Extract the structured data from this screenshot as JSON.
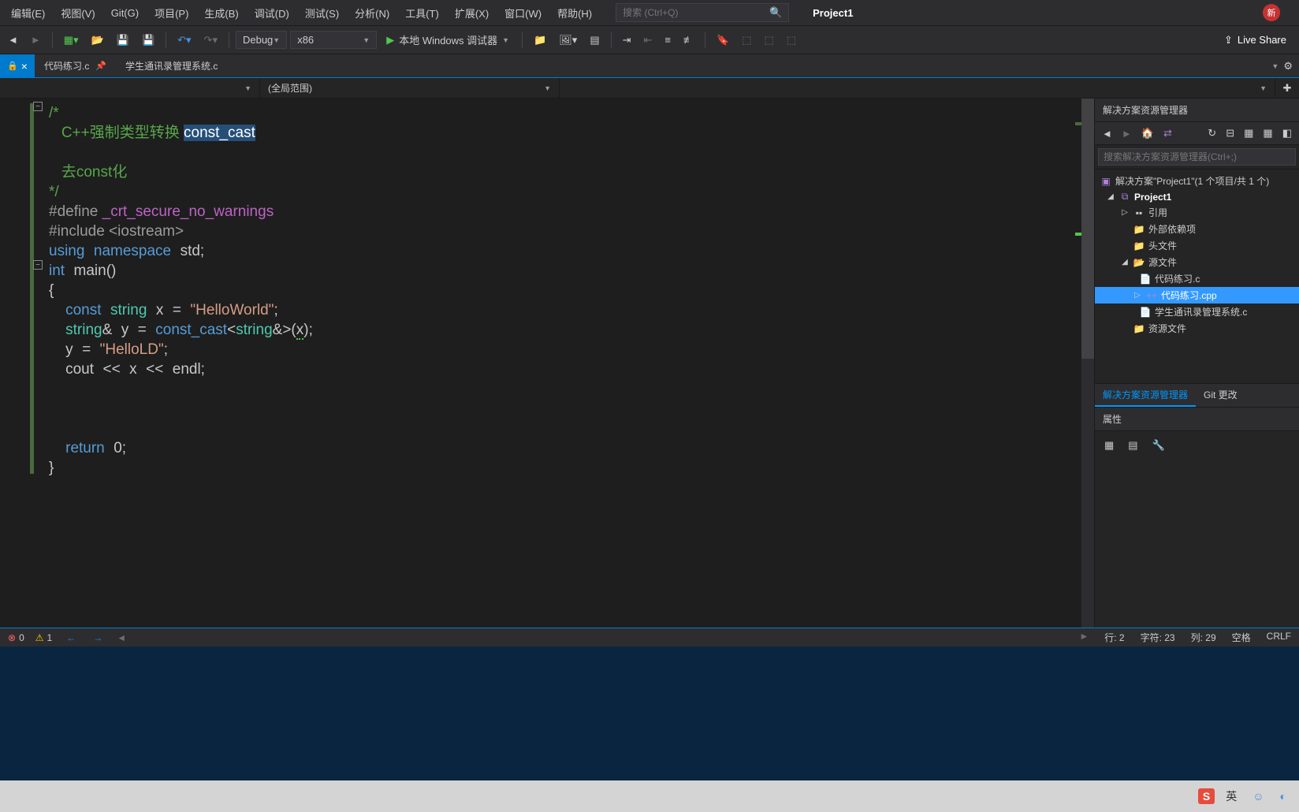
{
  "menu": {
    "items": [
      "编辑(E)",
      "视图(V)",
      "Git(G)",
      "项目(P)",
      "生成(B)",
      "调试(D)",
      "测试(S)",
      "分析(N)",
      "工具(T)",
      "扩展(X)",
      "窗口(W)",
      "帮助(H)"
    ],
    "search_placeholder": "搜索 (Ctrl+Q)",
    "project_name": "Project1",
    "badge": "新"
  },
  "toolbar": {
    "config": "Debug",
    "platform": "x86",
    "debugger": "本地 Windows 调试器",
    "live_share": "Live Share"
  },
  "tabs": {
    "items": [
      {
        "label": "代码练习.c",
        "active": false,
        "locked": true
      },
      {
        "label": "学生通讯录管理系统.c",
        "active": false,
        "locked": false
      }
    ]
  },
  "navbar": {
    "scope": "(全局范围)"
  },
  "code": {
    "comment_open": "/*",
    "comment_line1_prefix": "   C++强制类型转换 ",
    "comment_highlighted": "const_cast",
    "comment_line2": "   去const化",
    "comment_close": "*/",
    "define_kw": "#define",
    "define_name": " _crt_secure_no_warnings",
    "include_kw": "#include",
    "include_val": " <iostream>",
    "using_line": "using namespace std;",
    "main_sig": "int main()",
    "brace_open": "{",
    "const_decl_pre": "    const string x = ",
    "const_decl_str": "\"HelloWorld\"",
    "const_decl_post": ";",
    "cast_pre": "    string& y = const_cast<string&>(",
    "cast_var": "x",
    "cast_post": ");",
    "assign_pre": "    y = ",
    "assign_str": "\"HelloLD\"",
    "assign_post": ";",
    "cout_line": "    cout << x << endl;",
    "return_line": "    return 0;",
    "brace_close": "}"
  },
  "solution": {
    "panel_title": "解决方案资源管理器",
    "search_placeholder": "搜索解决方案资源管理器(Ctrl+;)",
    "root": "解决方案\"Project1\"(1 个项目/共 1 个)",
    "project": "Project1",
    "nodes": {
      "references": "引用",
      "external": "外部依赖项",
      "headers": "头文件",
      "sources": "源文件",
      "source_files": [
        "代码练习.c",
        "代码练习.cpp",
        "学生通讯录管理系统.c"
      ],
      "resources": "资源文件"
    },
    "tabs": {
      "active": "解决方案资源管理器",
      "other": "Git 更改"
    }
  },
  "properties": {
    "title": "属性"
  },
  "status": {
    "errors": "0",
    "warnings": "1",
    "line": "行: 2",
    "char": "字符: 23",
    "col": "列: 29",
    "mode": "空格",
    "ending": "CRLF"
  },
  "taskbar": {
    "ime": "英"
  }
}
